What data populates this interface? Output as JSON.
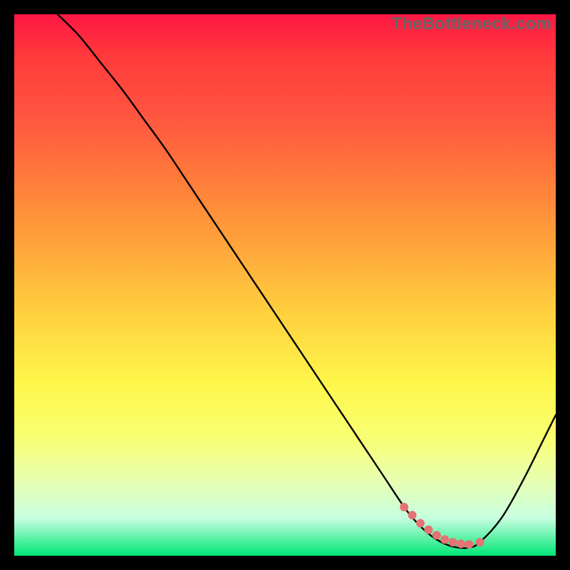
{
  "watermark": "TheBottleneck.com",
  "chart_data": {
    "type": "line",
    "title": "",
    "xlabel": "",
    "ylabel": "",
    "xlim": [
      0,
      100
    ],
    "ylim": [
      0,
      100
    ],
    "grid": false,
    "legend": false,
    "series": [
      {
        "name": "bottleneck-curve",
        "color": "#000000",
        "x": [
          8,
          12,
          16,
          20,
          24,
          28,
          32,
          36,
          40,
          44,
          48,
          52,
          56,
          60,
          64,
          68,
          72,
          74,
          76,
          78,
          80,
          82,
          84,
          86,
          90,
          94,
          98,
          100
        ],
        "y": [
          100,
          96,
          91,
          86,
          80.5,
          75,
          69,
          63,
          57,
          51,
          45,
          39,
          33,
          27,
          21,
          15,
          9,
          6.5,
          4.5,
          3,
          2,
          1.5,
          1.5,
          2.5,
          7,
          14,
          22,
          26
        ]
      }
    ],
    "markers": {
      "name": "min-region",
      "color": "#e57373",
      "shape": "circle",
      "radius_px": 6,
      "x": [
        72,
        73.5,
        75,
        76.5,
        78,
        79.5,
        81,
        82.5,
        84,
        86
      ],
      "y": [
        9,
        7.5,
        6,
        4.8,
        3.8,
        3,
        2.5,
        2.2,
        2.1,
        2.5
      ]
    }
  }
}
